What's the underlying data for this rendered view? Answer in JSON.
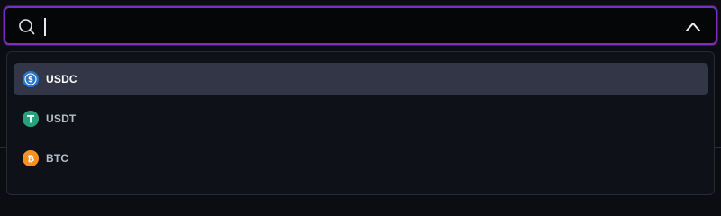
{
  "search": {
    "value": "",
    "placeholder": ""
  },
  "dropdown": {
    "expanded": true,
    "options": [
      {
        "label": "USDC",
        "icon": "usdc-icon",
        "color": "#2775ca",
        "selected": true
      },
      {
        "label": "USDT",
        "icon": "usdt-icon",
        "color": "#26a17b",
        "selected": false
      },
      {
        "label": "BTC",
        "icon": "btc-icon",
        "color": "#f7931a",
        "selected": false
      }
    ]
  },
  "colors": {
    "focus_border": "#7a2dc4",
    "selected_bg": "#333647",
    "panel_bg": "#0e1118"
  }
}
